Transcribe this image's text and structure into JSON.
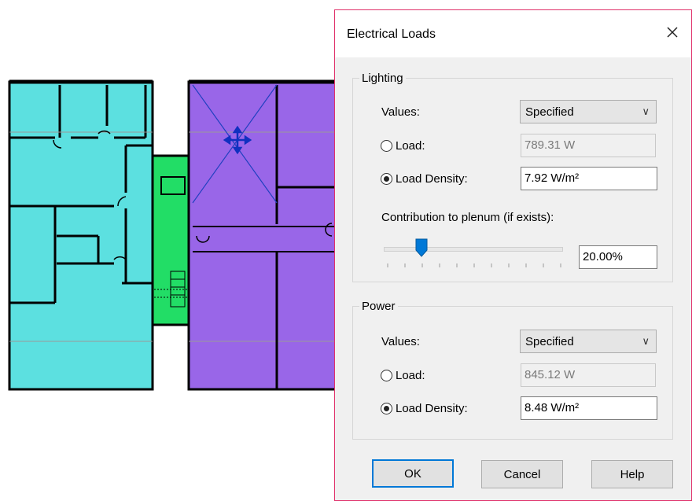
{
  "dialog": {
    "title": "Electrical Loads",
    "close_icon": "close-icon",
    "lighting": {
      "group_label": "Lighting",
      "values_label": "Values:",
      "values_selected": "Specified",
      "load_label": "Load:",
      "load_value": "789.31 W",
      "load_density_label": "Load Density:",
      "load_density_value": "7.92 W/m²",
      "selected_option": "Load Density",
      "contribution_label": "Contribution to plenum (if exists):",
      "contribution_value": "20.00%",
      "contribution_fraction": 0.2
    },
    "power": {
      "group_label": "Power",
      "values_label": "Values:",
      "values_selected": "Specified",
      "load_label": "Load:",
      "load_value": "845.12 W",
      "load_density_label": "Load Density:",
      "load_density_value": "8.48 W/m²",
      "selected_option": "Load Density"
    },
    "buttons": {
      "ok": "OK",
      "cancel": "Cancel",
      "help": "Help"
    }
  },
  "floor_plan": {
    "zone_colors": {
      "zone_a": "#5ce0e0",
      "zone_b": "#9966e8",
      "zone_c": "#22dd66"
    }
  }
}
